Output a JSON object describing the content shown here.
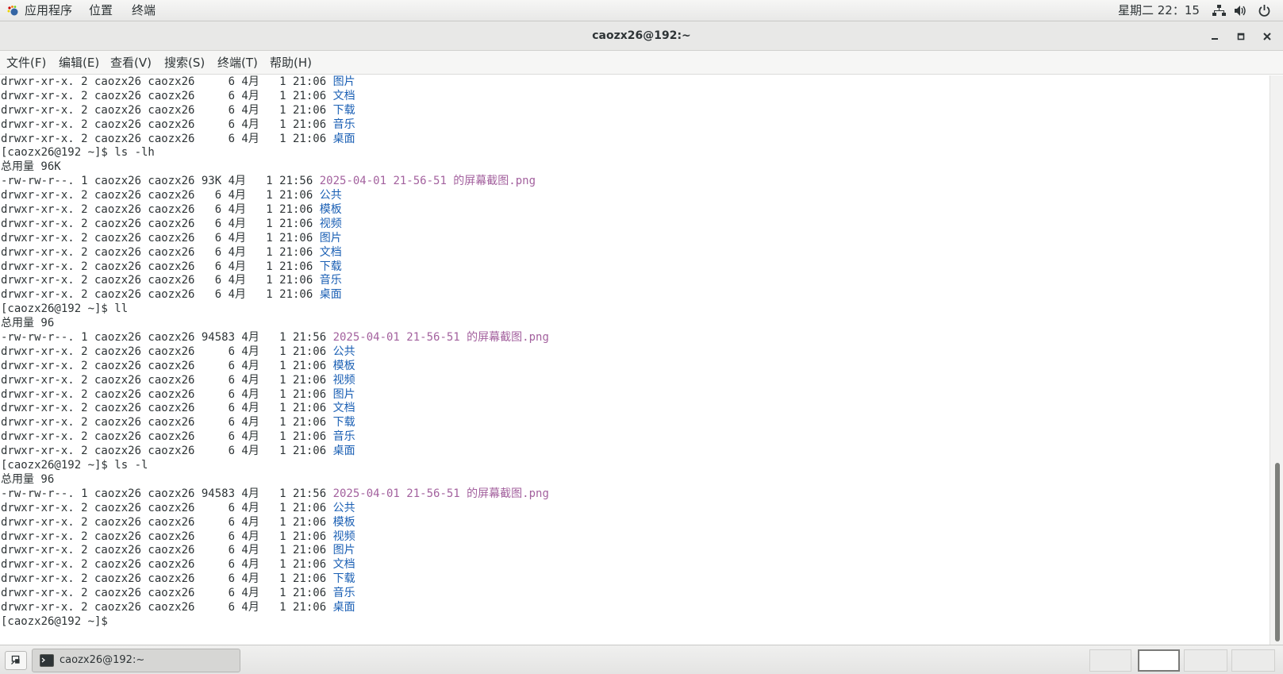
{
  "top_panel": {
    "apps": "应用程序",
    "places": "位置",
    "terminal": "终端",
    "clock": "星期二 22：15",
    "icons": [
      "network-icon",
      "volume-icon",
      "power-icon"
    ]
  },
  "window": {
    "title": "caozx26@192:~",
    "controls": [
      "minimize",
      "maximize",
      "close"
    ]
  },
  "menubar": {
    "file": "文件(F)",
    "edit": "编辑(E)",
    "view": "查看(V)",
    "search": "搜索(S)",
    "terminal": "终端(T)",
    "help": "帮助(H)"
  },
  "terminal": {
    "lines": [
      {
        "text": "drwxr-xr-x. 2 caozx26 caozx26     6 4月   1 21:06 ",
        "name": "图片",
        "kind": "dir"
      },
      {
        "text": "drwxr-xr-x. 2 caozx26 caozx26     6 4月   1 21:06 ",
        "name": "文档",
        "kind": "dir"
      },
      {
        "text": "drwxr-xr-x. 2 caozx26 caozx26     6 4月   1 21:06 ",
        "name": "下载",
        "kind": "dir"
      },
      {
        "text": "drwxr-xr-x. 2 caozx26 caozx26     6 4月   1 21:06 ",
        "name": "音乐",
        "kind": "dir"
      },
      {
        "text": "drwxr-xr-x. 2 caozx26 caozx26     6 4月   1 21:06 ",
        "name": "桌面",
        "kind": "dir"
      },
      {
        "text": "[caozx26@192 ~]$ ls -lh",
        "name": "",
        "kind": "plain"
      },
      {
        "text": "总用量 96K",
        "name": "",
        "kind": "plain"
      },
      {
        "text": "-rw-rw-r--. 1 caozx26 caozx26 93K 4月   1 21:56 ",
        "name": "2025-04-01 21-56-51 的屏幕截图.png",
        "kind": "img"
      },
      {
        "text": "drwxr-xr-x. 2 caozx26 caozx26   6 4月   1 21:06 ",
        "name": "公共",
        "kind": "dir"
      },
      {
        "text": "drwxr-xr-x. 2 caozx26 caozx26   6 4月   1 21:06 ",
        "name": "模板",
        "kind": "dir"
      },
      {
        "text": "drwxr-xr-x. 2 caozx26 caozx26   6 4月   1 21:06 ",
        "name": "视频",
        "kind": "dir"
      },
      {
        "text": "drwxr-xr-x. 2 caozx26 caozx26   6 4月   1 21:06 ",
        "name": "图片",
        "kind": "dir"
      },
      {
        "text": "drwxr-xr-x. 2 caozx26 caozx26   6 4月   1 21:06 ",
        "name": "文档",
        "kind": "dir"
      },
      {
        "text": "drwxr-xr-x. 2 caozx26 caozx26   6 4月   1 21:06 ",
        "name": "下载",
        "kind": "dir"
      },
      {
        "text": "drwxr-xr-x. 2 caozx26 caozx26   6 4月   1 21:06 ",
        "name": "音乐",
        "kind": "dir"
      },
      {
        "text": "drwxr-xr-x. 2 caozx26 caozx26   6 4月   1 21:06 ",
        "name": "桌面",
        "kind": "dir"
      },
      {
        "text": "[caozx26@192 ~]$ ll",
        "name": "",
        "kind": "plain"
      },
      {
        "text": "总用量 96",
        "name": "",
        "kind": "plain"
      },
      {
        "text": "-rw-rw-r--. 1 caozx26 caozx26 94583 4月   1 21:56 ",
        "name": "2025-04-01 21-56-51 的屏幕截图.png",
        "kind": "img"
      },
      {
        "text": "drwxr-xr-x. 2 caozx26 caozx26     6 4月   1 21:06 ",
        "name": "公共",
        "kind": "dir"
      },
      {
        "text": "drwxr-xr-x. 2 caozx26 caozx26     6 4月   1 21:06 ",
        "name": "模板",
        "kind": "dir"
      },
      {
        "text": "drwxr-xr-x. 2 caozx26 caozx26     6 4月   1 21:06 ",
        "name": "视频",
        "kind": "dir"
      },
      {
        "text": "drwxr-xr-x. 2 caozx26 caozx26     6 4月   1 21:06 ",
        "name": "图片",
        "kind": "dir"
      },
      {
        "text": "drwxr-xr-x. 2 caozx26 caozx26     6 4月   1 21:06 ",
        "name": "文档",
        "kind": "dir"
      },
      {
        "text": "drwxr-xr-x. 2 caozx26 caozx26     6 4月   1 21:06 ",
        "name": "下载",
        "kind": "dir"
      },
      {
        "text": "drwxr-xr-x. 2 caozx26 caozx26     6 4月   1 21:06 ",
        "name": "音乐",
        "kind": "dir"
      },
      {
        "text": "drwxr-xr-x. 2 caozx26 caozx26     6 4月   1 21:06 ",
        "name": "桌面",
        "kind": "dir"
      },
      {
        "text": "[caozx26@192 ~]$ ls -l",
        "name": "",
        "kind": "plain"
      },
      {
        "text": "总用量 96",
        "name": "",
        "kind": "plain"
      },
      {
        "text": "-rw-rw-r--. 1 caozx26 caozx26 94583 4月   1 21:56 ",
        "name": "2025-04-01 21-56-51 的屏幕截图.png",
        "kind": "img"
      },
      {
        "text": "drwxr-xr-x. 2 caozx26 caozx26     6 4月   1 21:06 ",
        "name": "公共",
        "kind": "dir"
      },
      {
        "text": "drwxr-xr-x. 2 caozx26 caozx26     6 4月   1 21:06 ",
        "name": "模板",
        "kind": "dir"
      },
      {
        "text": "drwxr-xr-x. 2 caozx26 caozx26     6 4月   1 21:06 ",
        "name": "视频",
        "kind": "dir"
      },
      {
        "text": "drwxr-xr-x. 2 caozx26 caozx26     6 4月   1 21:06 ",
        "name": "图片",
        "kind": "dir"
      },
      {
        "text": "drwxr-xr-x. 2 caozx26 caozx26     6 4月   1 21:06 ",
        "name": "文档",
        "kind": "dir"
      },
      {
        "text": "drwxr-xr-x. 2 caozx26 caozx26     6 4月   1 21:06 ",
        "name": "下载",
        "kind": "dir"
      },
      {
        "text": "drwxr-xr-x. 2 caozx26 caozx26     6 4月   1 21:06 ",
        "name": "音乐",
        "kind": "dir"
      },
      {
        "text": "drwxr-xr-x. 2 caozx26 caozx26     6 4月   1 21:06 ",
        "name": "桌面",
        "kind": "dir"
      },
      {
        "text": "[caozx26@192 ~]$",
        "name": "",
        "kind": "plain"
      }
    ],
    "colors": {
      "directory": "#1a5fb4",
      "image": "#a3619e",
      "text": "#2e3436"
    }
  },
  "taskbar": {
    "window_label": "caozx26@192:~",
    "workspaces": [
      {
        "active": false
      },
      {
        "active": true
      },
      {
        "active": false
      },
      {
        "active": false
      }
    ]
  }
}
